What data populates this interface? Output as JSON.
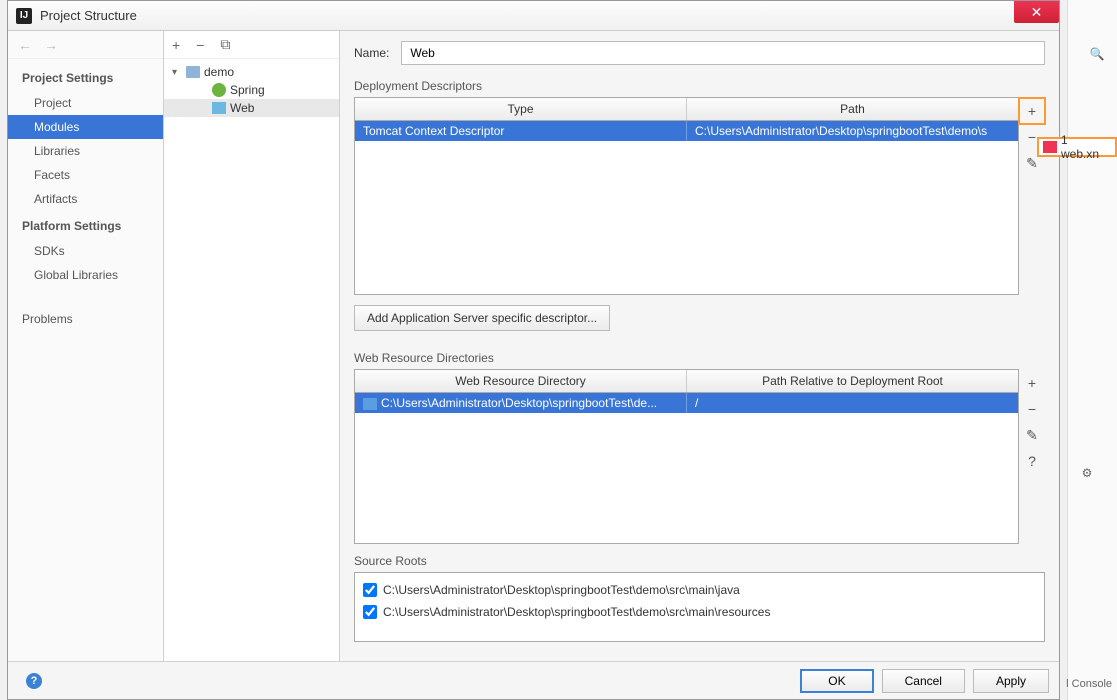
{
  "window": {
    "title": "Project Structure"
  },
  "nav": {
    "project_settings_header": "Project Settings",
    "project": "Project",
    "modules": "Modules",
    "libraries": "Libraries",
    "facets": "Facets",
    "artifacts": "Artifacts",
    "platform_settings_header": "Platform Settings",
    "sdks": "SDKs",
    "global_libraries": "Global Libraries",
    "problems": "Problems"
  },
  "tree": {
    "root": "demo",
    "spring": "Spring",
    "web": "Web"
  },
  "main": {
    "name_label": "Name:",
    "name_value": "Web",
    "deployment_descriptors_label": "Deployment Descriptors",
    "dd_headers": {
      "type": "Type",
      "path": "Path"
    },
    "dd_row": {
      "type": "Tomcat Context Descriptor",
      "path": "C:\\Users\\Administrator\\Desktop\\springbootTest\\demo\\s"
    },
    "add_descriptor_btn": "Add Application Server specific descriptor...",
    "web_resource_dirs_label": "Web Resource Directories",
    "wrd_headers": {
      "dir": "Web Resource Directory",
      "path": "Path Relative to Deployment Root"
    },
    "wrd_row": {
      "dir": "C:\\Users\\Administrator\\Desktop\\springbootTest\\de...",
      "path": "/"
    },
    "source_roots_label": "Source Roots",
    "source_roots": [
      "C:\\Users\\Administrator\\Desktop\\springbootTest\\demo\\src\\main\\java",
      "C:\\Users\\Administrator\\Desktop\\springbootTest\\demo\\src\\main\\resources"
    ]
  },
  "footer": {
    "ok": "OK",
    "cancel": "Cancel",
    "apply": "Apply"
  },
  "popup": {
    "label": "1  web.xn"
  },
  "bg": {
    "console": "l Console"
  }
}
